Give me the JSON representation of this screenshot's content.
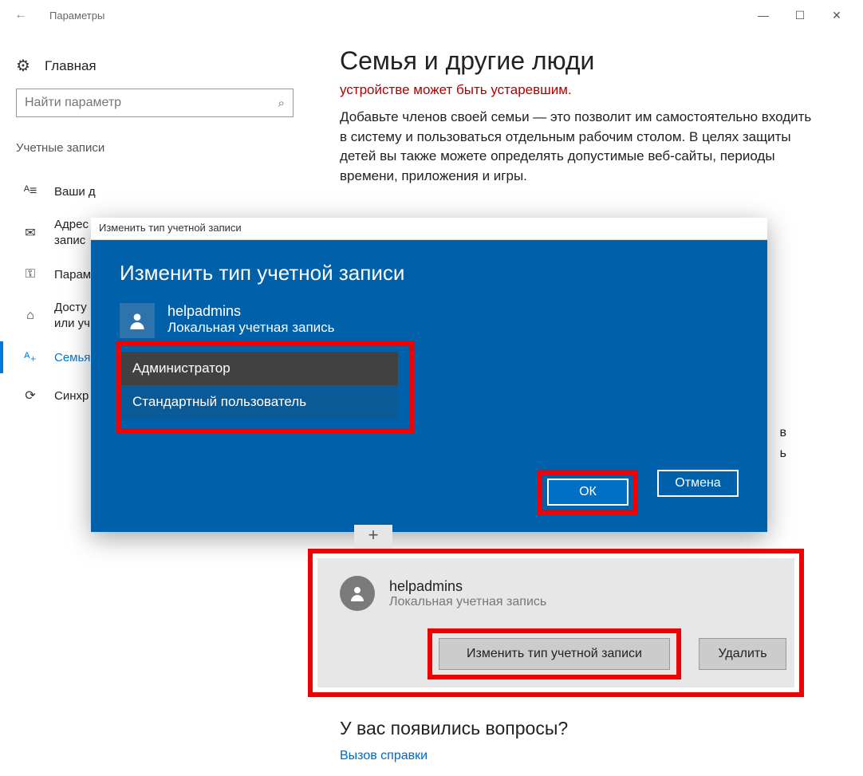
{
  "window": {
    "title": "Параметры",
    "min": "—",
    "max": "☐",
    "close": "✕",
    "back": "←"
  },
  "sidebar": {
    "home": "Главная",
    "search_placeholder": "Найти параметр",
    "section": "Учетные записи",
    "items": [
      {
        "icon": "ᴬ≡",
        "label": "Ваши д"
      },
      {
        "icon": "✉",
        "label": "Адрес\nзапис"
      },
      {
        "icon": "⚿",
        "label": "Парам"
      },
      {
        "icon": "⌂",
        "label": "Досту\nили уч"
      },
      {
        "icon": "ᴬ₊",
        "label": "Семья"
      },
      {
        "icon": "⟳",
        "label": "Синхр"
      }
    ]
  },
  "main": {
    "heading": "Семья и другие люди",
    "warning": "устройстве может быть устаревшим.",
    "paragraph": "Добавьте членов своей семьи — это позволит им самостоятельно входить в систему и пользоваться отдельным рабочим столом. В целях защиты детей вы также можете определять допустимые веб-сайты, периоды времени, приложения и игры.",
    "tail1": "в",
    "tail2": "ь"
  },
  "dialog": {
    "frame_title": "Изменить тип учетной записи",
    "heading": "Изменить тип учетной записи",
    "user_name": "helpadmins",
    "user_type": "Локальная учетная запись",
    "options": {
      "admin": "Администратор",
      "standard": "Стандартный пользователь"
    },
    "ok": "ОК",
    "cancel": "Отмена"
  },
  "card": {
    "user": "helpadmins",
    "sub": "Локальная учетная запись",
    "change": "Изменить тип учетной записи",
    "delete": "Удалить"
  },
  "questions": {
    "heading": "У вас появились вопросы?",
    "link": "Вызов справки"
  }
}
